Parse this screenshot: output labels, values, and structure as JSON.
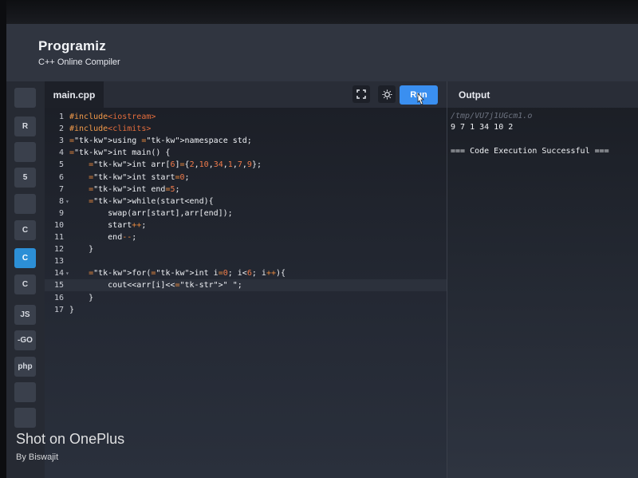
{
  "brand": {
    "name": "Programiz",
    "subtitle": "C++ Online Compiler"
  },
  "sidebar": {
    "items": [
      {
        "icon": "python-icon",
        "label": ""
      },
      {
        "icon": "r-icon",
        "label": "R"
      },
      {
        "icon": "sql-icon",
        "label": ""
      },
      {
        "icon": "html-icon",
        "label": "5"
      },
      {
        "icon": "java-icon",
        "label": ""
      },
      {
        "icon": "c-icon",
        "label": "C"
      },
      {
        "icon": "cpp-icon",
        "label": "C"
      },
      {
        "icon": "csharp-icon",
        "label": "C"
      },
      {
        "icon": "javascript-icon",
        "label": "JS"
      },
      {
        "icon": "go-icon",
        "label": "-GO"
      },
      {
        "icon": "php-icon",
        "label": "php"
      },
      {
        "icon": "swift-icon",
        "label": ""
      },
      {
        "icon": "rust-icon",
        "label": ""
      }
    ],
    "active_index": 6
  },
  "editor": {
    "file_tab": "main.cpp",
    "run_label": "Run",
    "active_line": 15,
    "lines": [
      {
        "n": "1",
        "fold": "",
        "code": "#include<iostream>"
      },
      {
        "n": "2",
        "fold": "",
        "code": "#include<climits>"
      },
      {
        "n": "3",
        "fold": "",
        "code": "using namespace std;"
      },
      {
        "n": "4",
        "fold": "",
        "code": "int main() {"
      },
      {
        "n": "5",
        "fold": "",
        "code": "    int arr[6]={2,10,34,1,7,9};"
      },
      {
        "n": "6",
        "fold": "",
        "code": "    int start=0;"
      },
      {
        "n": "7",
        "fold": "",
        "code": "    int end=5;"
      },
      {
        "n": "8",
        "fold": "▾",
        "code": "    while(start<end){"
      },
      {
        "n": "9",
        "fold": "",
        "code": "        swap(arr[start],arr[end]);"
      },
      {
        "n": "10",
        "fold": "",
        "code": "        start++;"
      },
      {
        "n": "11",
        "fold": "",
        "code": "        end--;"
      },
      {
        "n": "12",
        "fold": "",
        "code": "    }"
      },
      {
        "n": "13",
        "fold": "",
        "code": ""
      },
      {
        "n": "14",
        "fold": "▾",
        "code": "    for(int i=0; i<6; i++){"
      },
      {
        "n": "15",
        "fold": "",
        "code": "        cout<<arr[i]<<\" \";"
      },
      {
        "n": "16",
        "fold": "",
        "code": "    }"
      },
      {
        "n": "17",
        "fold": "",
        "code": "}"
      }
    ]
  },
  "output": {
    "title": "Output",
    "path": "/tmp/VU7j1UGcm1.o",
    "result": "9 7 1 34 10 2",
    "status": "=== Code Execution Successful ==="
  },
  "watermark": {
    "line1": "Shot on OnePlus",
    "line2": "By Biswajit"
  }
}
